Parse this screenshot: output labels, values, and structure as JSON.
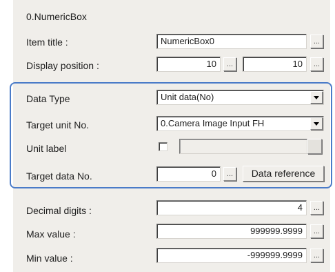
{
  "panel_title": "0.NumericBox",
  "rows": {
    "item_title": {
      "label": "Item title :",
      "value": "NumericBox0",
      "button": "..."
    },
    "display_position": {
      "label": "Display position :",
      "x": "10",
      "y": "10",
      "button": "..."
    },
    "data_type": {
      "label": "Data Type",
      "value": "Unit data(No)"
    },
    "target_unit": {
      "label": "Target unit No.",
      "value": "0.Camera Image Input FH"
    },
    "unit_label": {
      "label": "Unit label",
      "checked": false,
      "value": ""
    },
    "target_data": {
      "label": "Target data No.",
      "value": "0",
      "button": "...",
      "reference_button": "Data reference"
    },
    "decimal_digits": {
      "label": "Decimal digits :",
      "value": "4",
      "button": "..."
    },
    "max_value": {
      "label": "Max value :",
      "value": "999999.9999",
      "button": "..."
    },
    "min_value": {
      "label": "Min value :",
      "value": "-999999.9999",
      "button": "..."
    }
  },
  "colors": {
    "group_border": "#4a7bc8",
    "panel_bg": "#f0eeea"
  }
}
